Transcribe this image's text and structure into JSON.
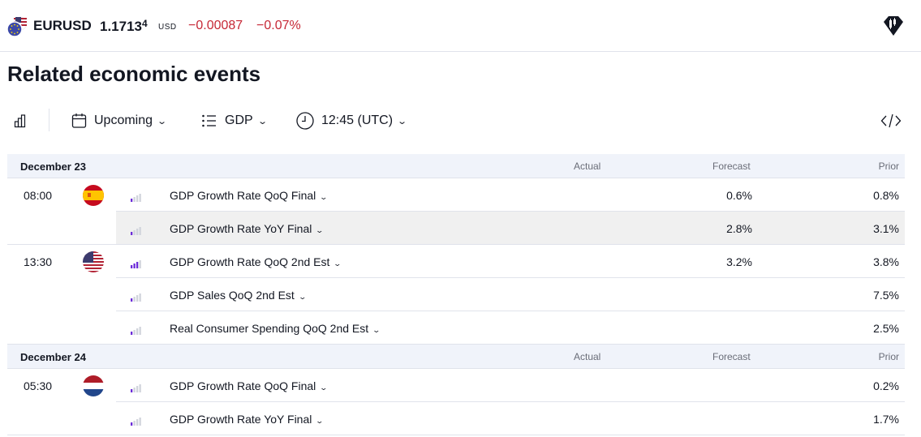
{
  "header": {
    "symbol": "EURUSD",
    "price_main": "1.1713",
    "price_sup": "4",
    "currency": "USD",
    "change": "−0.00087",
    "change_percent": "−0.07%",
    "logo_icon": "tradingview-logo-icon",
    "negative_color": "#c62836"
  },
  "title": "Related economic events",
  "toolbar": {
    "chart_icon": "bar-chart-icon",
    "period": "Upcoming",
    "category": "GDP",
    "time": "12:45 (UTC)",
    "embed_icon": "code-icon"
  },
  "columns": {
    "actual": "Actual",
    "forecast": "Forecast",
    "prior": "Prior"
  },
  "groups": [
    {
      "date": "December 23",
      "rows": [
        {
          "time": "08:00",
          "flag": "spain-flag",
          "importance": 1,
          "event": "GDP Growth Rate QoQ Final",
          "actual": "",
          "forecast": "0.6%",
          "prior": "0.8%"
        },
        {
          "time": "",
          "flag": "",
          "importance": 1,
          "event": "GDP Growth Rate YoY Final",
          "actual": "",
          "forecast": "2.8%",
          "prior": "3.1%"
        },
        {
          "time": "13:30",
          "flag": "us-flag",
          "importance": 3,
          "event": "GDP Growth Rate QoQ 2nd Est",
          "actual": "",
          "forecast": "3.2%",
          "prior": "3.8%"
        },
        {
          "time": "",
          "flag": "",
          "importance": 1,
          "event": "GDP Sales QoQ 2nd Est",
          "actual": "",
          "forecast": "",
          "prior": "7.5%"
        },
        {
          "time": "",
          "flag": "",
          "importance": 1,
          "event": "Real Consumer Spending QoQ 2nd Est",
          "actual": "",
          "forecast": "",
          "prior": "2.5%"
        }
      ]
    },
    {
      "date": "December 24",
      "rows": [
        {
          "time": "05:30",
          "flag": "netherlands-flag",
          "importance": 1,
          "event": "GDP Growth Rate QoQ Final",
          "actual": "",
          "forecast": "",
          "prior": "0.2%"
        },
        {
          "time": "",
          "flag": "",
          "importance": 1,
          "event": "GDP Growth Rate YoY Final",
          "actual": "",
          "forecast": "",
          "prior": "1.7%"
        }
      ]
    }
  ]
}
